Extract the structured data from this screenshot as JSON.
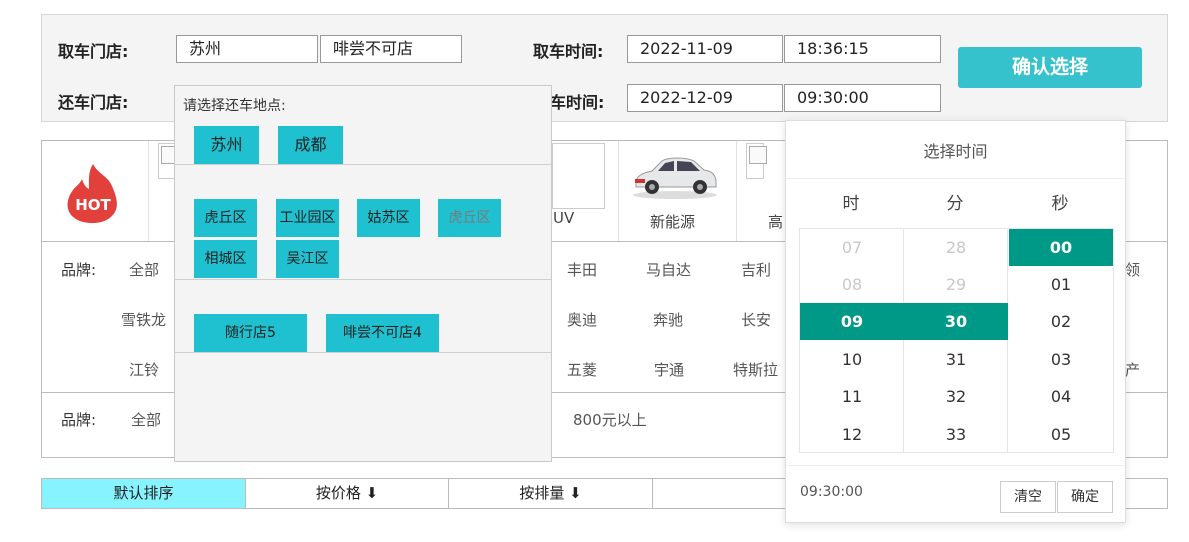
{
  "search": {
    "pickup_store_label": "取车门店:",
    "pickup_city": "苏州",
    "pickup_store": "啡尝不可店",
    "pickup_time_label": "取车时间:",
    "pickup_date": "2022-11-09",
    "pickup_time": "18:36:15",
    "return_store_label": "还车门店:",
    "return_time_label": "车时间:",
    "return_date": "2022-12-09",
    "return_time": "09:30:00",
    "confirm_label": "确认选择"
  },
  "car_strip": {
    "hot_text": "HOT",
    "visible_labels": [
      "UV",
      "新能源",
      "高"
    ]
  },
  "brand_filter": {
    "label": "品牌:",
    "all": "全部",
    "rows": [
      [
        "丰田",
        "马自达",
        "吉利"
      ],
      [
        "奥迪",
        "奔驰",
        "长安"
      ],
      [
        "五菱",
        "宇通",
        "特斯拉"
      ]
    ],
    "left_col": [
      "雪铁龙",
      "江铃"
    ],
    "right_edge": [
      "领",
      "产"
    ]
  },
  "price_filter": {
    "label": "品牌:",
    "all": "全部",
    "suffix": "800元以上"
  },
  "sort_bar": {
    "tabs": [
      "默认排序",
      "按价格 ⬇",
      "按排量 ⬇"
    ]
  },
  "location_dropdown": {
    "title": "请选择还车地点:",
    "cities": [
      "苏州",
      "成都"
    ],
    "districts": [
      "虎丘区",
      "工业园区",
      "姑苏区",
      "虎丘区",
      "相城区",
      "吴江区"
    ],
    "stores": [
      "随行店5",
      "啡尝不可店4"
    ]
  },
  "time_picker": {
    "title": "选择时间",
    "headers": [
      "时",
      "分",
      "秒"
    ],
    "hours": [
      "07",
      "08",
      "09",
      "10",
      "11",
      "12"
    ],
    "minutes": [
      "28",
      "29",
      "30",
      "31",
      "32",
      "33"
    ],
    "seconds": [
      "00",
      "01",
      "02",
      "03",
      "04",
      "05"
    ],
    "current_value": "09:30:00",
    "clear_label": "清空",
    "ok_label": "确定"
  },
  "colors": {
    "accent": "#35c2cc",
    "chip": "#1fc0cf",
    "selected_time": "#009886",
    "active_sort": "#86f3ff"
  }
}
